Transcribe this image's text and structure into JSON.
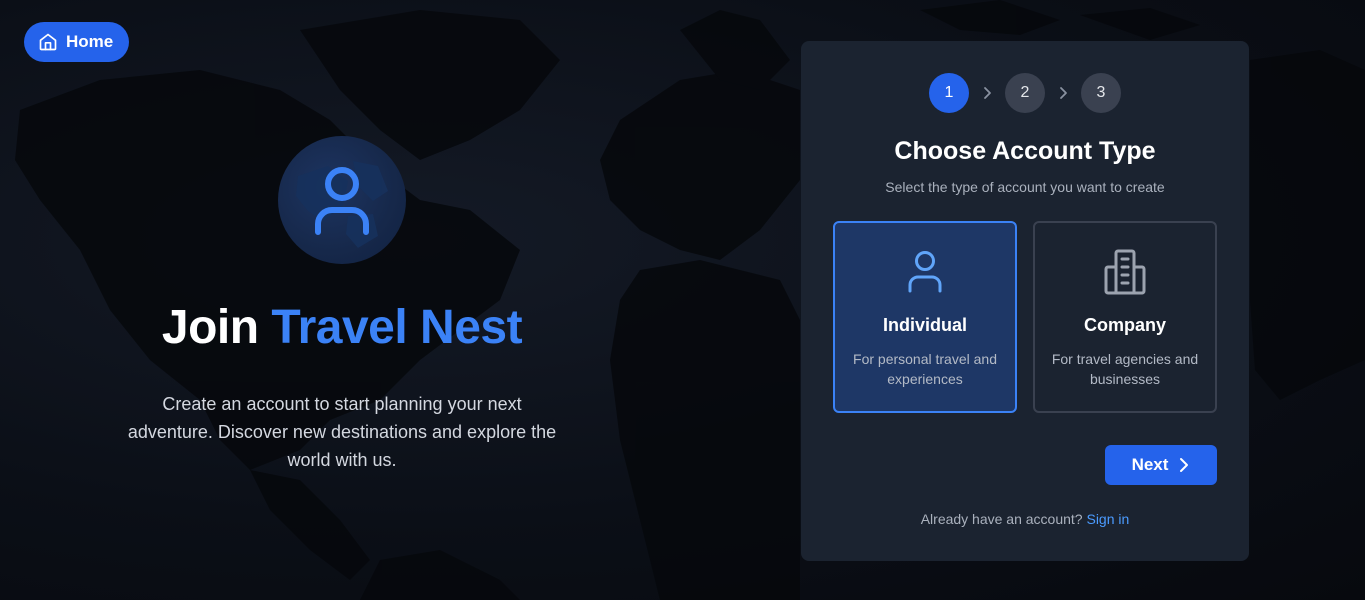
{
  "nav": {
    "home_label": "Home"
  },
  "hero": {
    "title_plain": "Join",
    "title_accent": "Travel Nest",
    "description": "Create an account to start planning your next adventure. Discover new destinations and explore the world with us."
  },
  "signup": {
    "steps": [
      "1",
      "2",
      "3"
    ],
    "active_step": 1,
    "title": "Choose Account Type",
    "subtitle": "Select the type of account you want to create",
    "options": [
      {
        "title": "Individual",
        "description": "For personal travel and experiences",
        "icon": "person-icon",
        "selected": true
      },
      {
        "title": "Company",
        "description": "For travel agencies and businesses",
        "icon": "building-icon",
        "selected": false
      }
    ],
    "next_label": "Next",
    "signin_prompt": "Already have an account?",
    "signin_link": "Sign in"
  },
  "colors": {
    "accent": "#2563eb",
    "accent_text": "#3b82f6",
    "card_bg": "#1b2330",
    "selected_bg": "#1e3766",
    "link": "#4b9bff"
  }
}
